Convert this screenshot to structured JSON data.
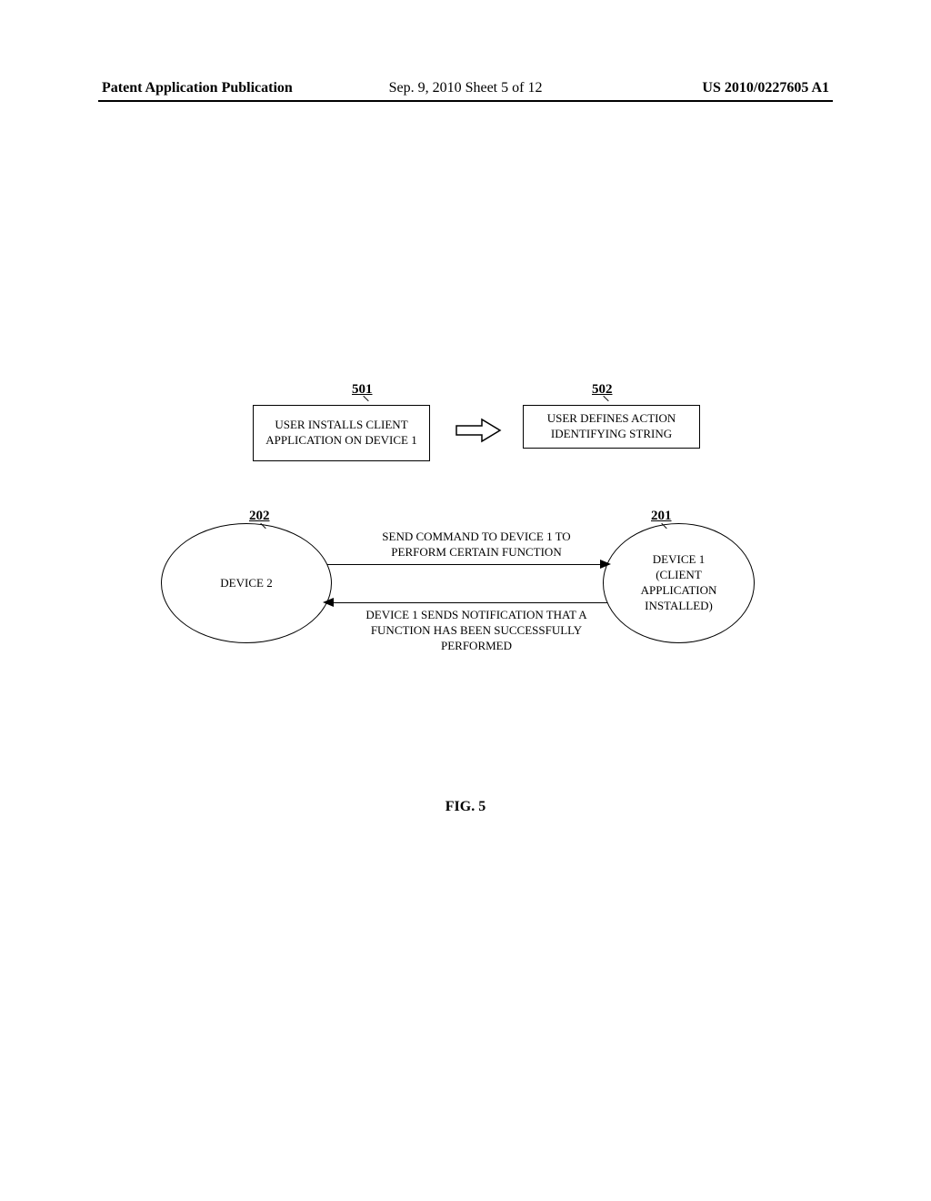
{
  "header": {
    "left": "Patent Application Publication",
    "center": "Sep. 9, 2010  Sheet 5 of 12",
    "right": "US 2010/0227605 A1"
  },
  "labels": {
    "l501": "501",
    "l502": "502",
    "l202": "202",
    "l201": "201"
  },
  "boxes": {
    "b501": "USER INSTALLS CLIENT APPLICATION ON DEVICE 1",
    "b502": "USER DEFINES ACTION IDENTIFYING STRING"
  },
  "ellipses": {
    "e202": "DEVICE 2",
    "e201_l1": "DEVICE 1",
    "e201_l2": "(CLIENT",
    "e201_l3": "APPLICATION",
    "e201_l4": "INSTALLED)"
  },
  "messages": {
    "top": "SEND COMMAND TO DEVICE 1 TO PERFORM CERTAIN FUNCTION",
    "bottom": "DEVICE 1 SENDS NOTIFICATION THAT A FUNCTION HAS BEEN SUCCESSFULLY PERFORMED"
  },
  "figure": "FIG. 5"
}
